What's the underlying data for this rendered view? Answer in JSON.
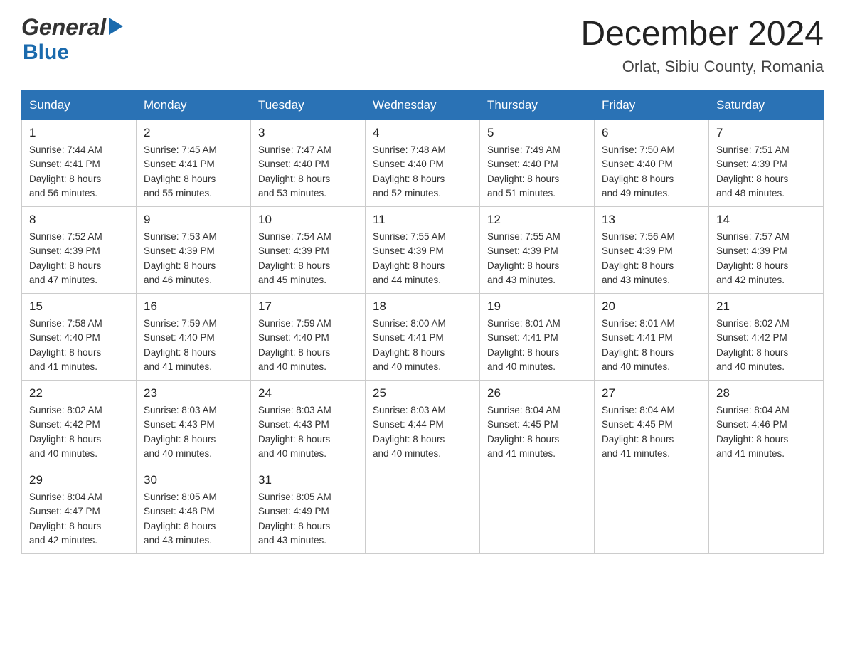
{
  "logo": {
    "line1": "General",
    "line2": "Blue"
  },
  "title": "December 2024",
  "subtitle": "Orlat, Sibiu County, Romania",
  "weekdays": [
    "Sunday",
    "Monday",
    "Tuesday",
    "Wednesday",
    "Thursday",
    "Friday",
    "Saturday"
  ],
  "weeks": [
    [
      {
        "day": "1",
        "sunrise": "7:44 AM",
        "sunset": "4:41 PM",
        "daylight": "8 hours and 56 minutes."
      },
      {
        "day": "2",
        "sunrise": "7:45 AM",
        "sunset": "4:41 PM",
        "daylight": "8 hours and 55 minutes."
      },
      {
        "day": "3",
        "sunrise": "7:47 AM",
        "sunset": "4:40 PM",
        "daylight": "8 hours and 53 minutes."
      },
      {
        "day": "4",
        "sunrise": "7:48 AM",
        "sunset": "4:40 PM",
        "daylight": "8 hours and 52 minutes."
      },
      {
        "day": "5",
        "sunrise": "7:49 AM",
        "sunset": "4:40 PM",
        "daylight": "8 hours and 51 minutes."
      },
      {
        "day": "6",
        "sunrise": "7:50 AM",
        "sunset": "4:40 PM",
        "daylight": "8 hours and 49 minutes."
      },
      {
        "day": "7",
        "sunrise": "7:51 AM",
        "sunset": "4:39 PM",
        "daylight": "8 hours and 48 minutes."
      }
    ],
    [
      {
        "day": "8",
        "sunrise": "7:52 AM",
        "sunset": "4:39 PM",
        "daylight": "8 hours and 47 minutes."
      },
      {
        "day": "9",
        "sunrise": "7:53 AM",
        "sunset": "4:39 PM",
        "daylight": "8 hours and 46 minutes."
      },
      {
        "day": "10",
        "sunrise": "7:54 AM",
        "sunset": "4:39 PM",
        "daylight": "8 hours and 45 minutes."
      },
      {
        "day": "11",
        "sunrise": "7:55 AM",
        "sunset": "4:39 PM",
        "daylight": "8 hours and 44 minutes."
      },
      {
        "day": "12",
        "sunrise": "7:55 AM",
        "sunset": "4:39 PM",
        "daylight": "8 hours and 43 minutes."
      },
      {
        "day": "13",
        "sunrise": "7:56 AM",
        "sunset": "4:39 PM",
        "daylight": "8 hours and 43 minutes."
      },
      {
        "day": "14",
        "sunrise": "7:57 AM",
        "sunset": "4:39 PM",
        "daylight": "8 hours and 42 minutes."
      }
    ],
    [
      {
        "day": "15",
        "sunrise": "7:58 AM",
        "sunset": "4:40 PM",
        "daylight": "8 hours and 41 minutes."
      },
      {
        "day": "16",
        "sunrise": "7:59 AM",
        "sunset": "4:40 PM",
        "daylight": "8 hours and 41 minutes."
      },
      {
        "day": "17",
        "sunrise": "7:59 AM",
        "sunset": "4:40 PM",
        "daylight": "8 hours and 40 minutes."
      },
      {
        "day": "18",
        "sunrise": "8:00 AM",
        "sunset": "4:41 PM",
        "daylight": "8 hours and 40 minutes."
      },
      {
        "day": "19",
        "sunrise": "8:01 AM",
        "sunset": "4:41 PM",
        "daylight": "8 hours and 40 minutes."
      },
      {
        "day": "20",
        "sunrise": "8:01 AM",
        "sunset": "4:41 PM",
        "daylight": "8 hours and 40 minutes."
      },
      {
        "day": "21",
        "sunrise": "8:02 AM",
        "sunset": "4:42 PM",
        "daylight": "8 hours and 40 minutes."
      }
    ],
    [
      {
        "day": "22",
        "sunrise": "8:02 AM",
        "sunset": "4:42 PM",
        "daylight": "8 hours and 40 minutes."
      },
      {
        "day": "23",
        "sunrise": "8:03 AM",
        "sunset": "4:43 PM",
        "daylight": "8 hours and 40 minutes."
      },
      {
        "day": "24",
        "sunrise": "8:03 AM",
        "sunset": "4:43 PM",
        "daylight": "8 hours and 40 minutes."
      },
      {
        "day": "25",
        "sunrise": "8:03 AM",
        "sunset": "4:44 PM",
        "daylight": "8 hours and 40 minutes."
      },
      {
        "day": "26",
        "sunrise": "8:04 AM",
        "sunset": "4:45 PM",
        "daylight": "8 hours and 41 minutes."
      },
      {
        "day": "27",
        "sunrise": "8:04 AM",
        "sunset": "4:45 PM",
        "daylight": "8 hours and 41 minutes."
      },
      {
        "day": "28",
        "sunrise": "8:04 AM",
        "sunset": "4:46 PM",
        "daylight": "8 hours and 41 minutes."
      }
    ],
    [
      {
        "day": "29",
        "sunrise": "8:04 AM",
        "sunset": "4:47 PM",
        "daylight": "8 hours and 42 minutes."
      },
      {
        "day": "30",
        "sunrise": "8:05 AM",
        "sunset": "4:48 PM",
        "daylight": "8 hours and 43 minutes."
      },
      {
        "day": "31",
        "sunrise": "8:05 AM",
        "sunset": "4:49 PM",
        "daylight": "8 hours and 43 minutes."
      },
      null,
      null,
      null,
      null
    ]
  ],
  "labels": {
    "sunrise": "Sunrise:",
    "sunset": "Sunset:",
    "daylight": "Daylight:"
  }
}
